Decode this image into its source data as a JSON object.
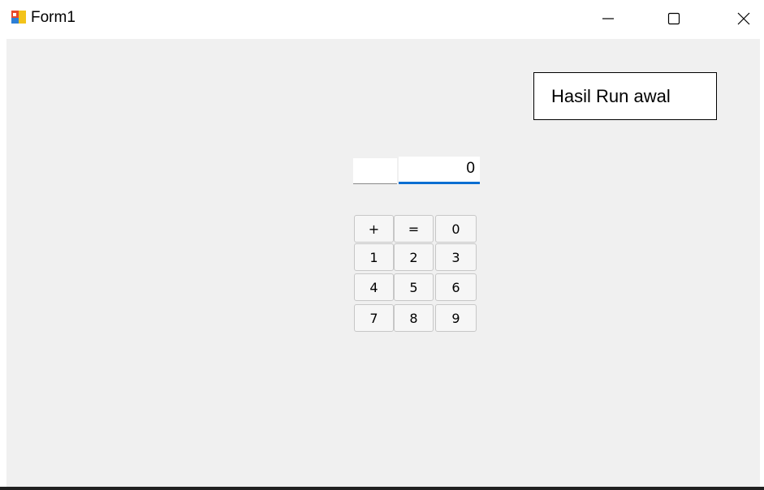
{
  "window": {
    "title": "Form1"
  },
  "note": {
    "text": "Hasil Run awal"
  },
  "inputs": {
    "operator_value": "",
    "display_value": "0"
  },
  "keypad": {
    "rows": [
      [
        "+",
        "=",
        "0"
      ],
      [
        "1",
        "2",
        "3"
      ],
      [
        "4",
        "5",
        "6"
      ],
      [
        "7",
        "8",
        "9"
      ]
    ]
  },
  "colors": {
    "accent": "#0a6ed1",
    "client_bg": "#f0f0f0"
  }
}
